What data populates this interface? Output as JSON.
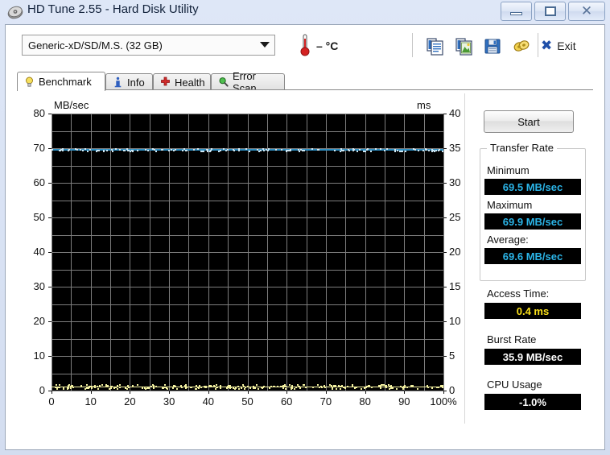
{
  "window": {
    "title": "HD Tune 2.55 - Hard Disk Utility",
    "icon": "hard-disk-icon",
    "minimize_label": "",
    "maximize_label": "",
    "close_label": "✕"
  },
  "toolbar": {
    "device": "Generic-xD/SD/M.S. (32 GB)",
    "temperature": "– °C",
    "thermometer_icon": "thermometer-icon",
    "icons": [
      {
        "name": "copy-text-icon"
      },
      {
        "name": "copy-image-icon"
      },
      {
        "name": "save-icon"
      },
      {
        "name": "options-icon"
      }
    ],
    "exit_label": "Exit",
    "exit_icon": "close-x-icon"
  },
  "tabs": [
    {
      "label": "Benchmark",
      "icon": "lightbulb-icon",
      "active": true
    },
    {
      "label": "Info",
      "icon": "info-icon",
      "active": false
    },
    {
      "label": "Health",
      "icon": "red-cross-icon",
      "active": false
    },
    {
      "label": "Error Scan",
      "icon": "magnifier-icon",
      "active": false
    }
  ],
  "side": {
    "start_label": "Start",
    "transfer_group_title": "Transfer Rate",
    "minimum_label": "Minimum",
    "minimum_value": "69.5 MB/sec",
    "maximum_label": "Maximum",
    "maximum_value": "69.9 MB/sec",
    "average_label": "Average:",
    "average_value": "69.6 MB/sec",
    "access_label": "Access Time:",
    "access_value": "0.4 ms",
    "burst_label": "Burst Rate",
    "burst_value": "35.9 MB/sec",
    "cpu_label": "CPU Usage",
    "cpu_value": "-1.0%"
  },
  "colors": {
    "transfer_line": "#2f91c4",
    "access_dots": "#f2f0a0",
    "plot_background": "#000000",
    "grid": "#7d7d7d",
    "lcd_cyan": "#2bb5e8",
    "lcd_yellow": "#fbe11a",
    "lcd_white": "#ffffff"
  },
  "chart_data": {
    "type": "line",
    "title": "",
    "xlabel": "",
    "ylabel": "MB/sec",
    "y2label": "ms",
    "xlim": [
      0,
      100
    ],
    "ylim": [
      0,
      80
    ],
    "y2lim": [
      0,
      40
    ],
    "grid": true,
    "legend": "none",
    "x_ticks": [
      0,
      10,
      20,
      30,
      40,
      50,
      60,
      70,
      80,
      90,
      100
    ],
    "x_tick_labels": [
      "0",
      "10",
      "20",
      "30",
      "40",
      "50",
      "60",
      "70",
      "80",
      "90",
      "100%"
    ],
    "y_ticks": [
      0,
      10,
      20,
      30,
      40,
      50,
      60,
      70,
      80
    ],
    "y_tick_labels": [
      "0",
      "10",
      "20",
      "30",
      "40",
      "50",
      "60",
      "70",
      "80"
    ],
    "y2_ticks": [
      0,
      5,
      10,
      15,
      20,
      25,
      30,
      35,
      40
    ],
    "y2_tick_labels": [
      "0",
      "5",
      "10",
      "15",
      "20",
      "25",
      "30",
      "35",
      "40"
    ],
    "series": [
      {
        "name": "Transfer rate",
        "axis": "left",
        "units": "MB/sec",
        "color": "#2f91c4",
        "x": [
          0,
          5,
          10,
          15,
          20,
          25,
          30,
          35,
          40,
          45,
          50,
          55,
          60,
          65,
          70,
          75,
          80,
          85,
          90,
          95,
          100
        ],
        "values": [
          69.6,
          69.6,
          69.7,
          69.6,
          69.6,
          69.7,
          69.6,
          69.6,
          69.6,
          69.7,
          69.6,
          69.6,
          69.7,
          69.6,
          69.6,
          69.6,
          69.7,
          69.6,
          69.6,
          69.7,
          69.6
        ]
      },
      {
        "name": "Access time",
        "axis": "right",
        "units": "ms",
        "color": "#f2f0a0",
        "x": [
          0,
          5,
          10,
          15,
          20,
          25,
          30,
          35,
          40,
          45,
          50,
          55,
          60,
          65,
          70,
          75,
          80,
          85,
          90,
          95,
          100
        ],
        "values": [
          0.4,
          0.4,
          0.4,
          0.4,
          0.4,
          0.4,
          0.4,
          0.4,
          0.4,
          0.4,
          0.4,
          0.4,
          0.4,
          0.4,
          0.4,
          0.4,
          0.4,
          0.4,
          0.4,
          0.4,
          0.4
        ]
      }
    ]
  }
}
